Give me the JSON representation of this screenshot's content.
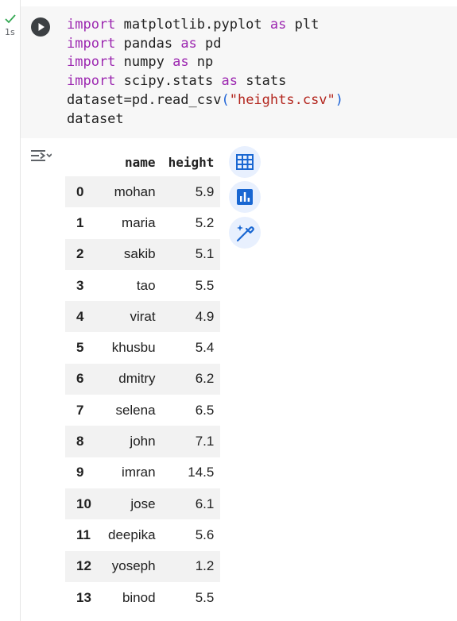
{
  "execution": {
    "time": "1s"
  },
  "code": {
    "lines": [
      [
        {
          "t": "kw",
          "v": "import"
        },
        {
          "t": "plain",
          "v": " matplotlib.pyplot "
        },
        {
          "t": "kw",
          "v": "as"
        },
        {
          "t": "plain",
          "v": " plt"
        }
      ],
      [
        {
          "t": "kw",
          "v": "import"
        },
        {
          "t": "plain",
          "v": " pandas "
        },
        {
          "t": "kw",
          "v": "as"
        },
        {
          "t": "plain",
          "v": " pd"
        }
      ],
      [
        {
          "t": "kw",
          "v": "import"
        },
        {
          "t": "plain",
          "v": " numpy "
        },
        {
          "t": "kw",
          "v": "as"
        },
        {
          "t": "plain",
          "v": " np"
        }
      ],
      [
        {
          "t": "kw",
          "v": "import"
        },
        {
          "t": "plain",
          "v": " scipy.stats "
        },
        {
          "t": "kw",
          "v": "as"
        },
        {
          "t": "plain",
          "v": " stats"
        }
      ],
      [
        {
          "t": "plain",
          "v": "dataset=pd.read_csv"
        },
        {
          "t": "paren",
          "v": "("
        },
        {
          "t": "str",
          "v": "\"heights.csv\""
        },
        {
          "t": "paren",
          "v": ")"
        }
      ],
      [
        {
          "t": "plain",
          "v": "dataset"
        }
      ]
    ]
  },
  "table": {
    "columns": [
      "name",
      "height"
    ],
    "rows": [
      {
        "index": "0",
        "name": "mohan",
        "height": "5.9"
      },
      {
        "index": "1",
        "name": "maria",
        "height": "5.2"
      },
      {
        "index": "2",
        "name": "sakib",
        "height": "5.1"
      },
      {
        "index": "3",
        "name": "tao",
        "height": "5.5"
      },
      {
        "index": "4",
        "name": "virat",
        "height": "4.9"
      },
      {
        "index": "5",
        "name": "khusbu",
        "height": "5.4"
      },
      {
        "index": "6",
        "name": "dmitry",
        "height": "6.2"
      },
      {
        "index": "7",
        "name": "selena",
        "height": "6.5"
      },
      {
        "index": "8",
        "name": "john",
        "height": "7.1"
      },
      {
        "index": "9",
        "name": "imran",
        "height": "14.5"
      },
      {
        "index": "10",
        "name": "jose",
        "height": "6.1"
      },
      {
        "index": "11",
        "name": "deepika",
        "height": "5.6"
      },
      {
        "index": "12",
        "name": "yoseph",
        "height": "1.2"
      },
      {
        "index": "13",
        "name": "binod",
        "height": "5.5"
      }
    ]
  },
  "icons": {
    "run": "play-icon",
    "output_menu": "output-actions-icon",
    "table_view": "table-icon",
    "chart": "bar-chart-icon",
    "magic": "magic-wand-icon"
  },
  "colors": {
    "keyword": "#9c27b0",
    "string": "#b3261e",
    "paren": "#1e63d6",
    "accent": "#1967d2",
    "success": "#34a853"
  }
}
